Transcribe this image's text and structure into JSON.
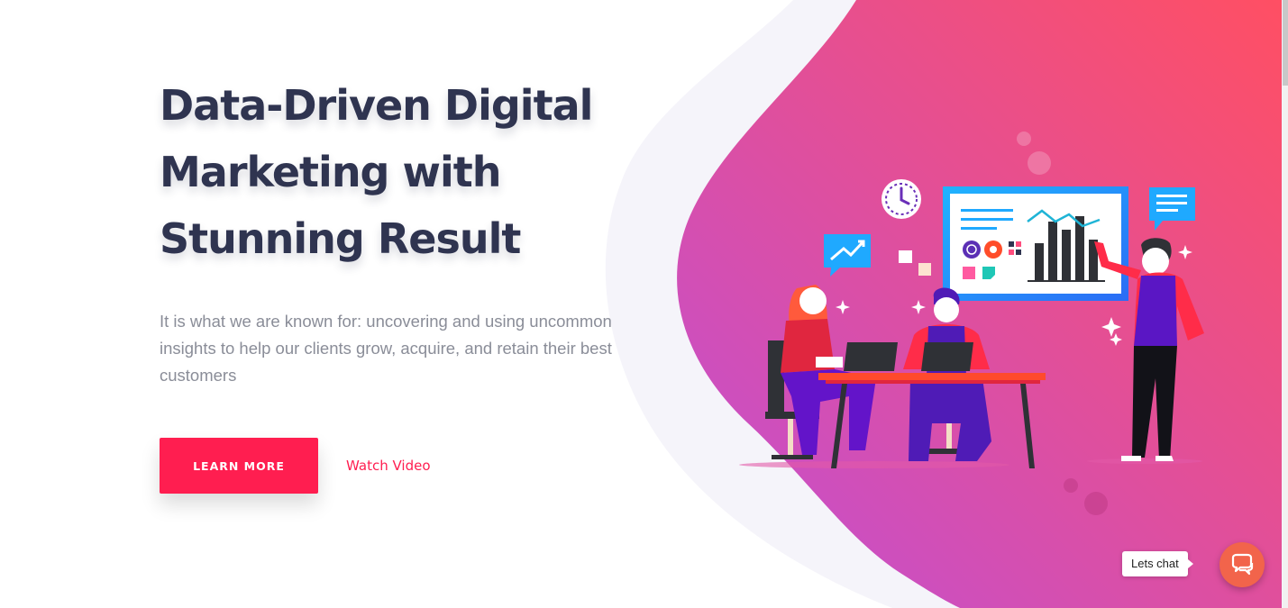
{
  "hero": {
    "title": "Data-Driven Digital Marketing with Stunning Result",
    "subtitle": "It is what we are known for: uncovering and using uncommon insights to help our clients grow, acquire, and retain their best customers",
    "learn_more_label": "LEARN MORE",
    "watch_video_label": "Watch Video"
  },
  "chat": {
    "label": "Lets chat",
    "icon": "chat-icon"
  },
  "illustration": {
    "icons": [
      "clock-icon",
      "trend-chat-icon",
      "message-icon",
      "globe-icon",
      "gear-icon",
      "grid-icon",
      "sparkle-icon"
    ]
  },
  "colors": {
    "accent": "#ff1e50",
    "title": "#2f3450",
    "subtitle": "#8a8d98",
    "gradient_start": "#c04fd6",
    "gradient_end": "#ff4f63",
    "chat": "#f2644b"
  }
}
